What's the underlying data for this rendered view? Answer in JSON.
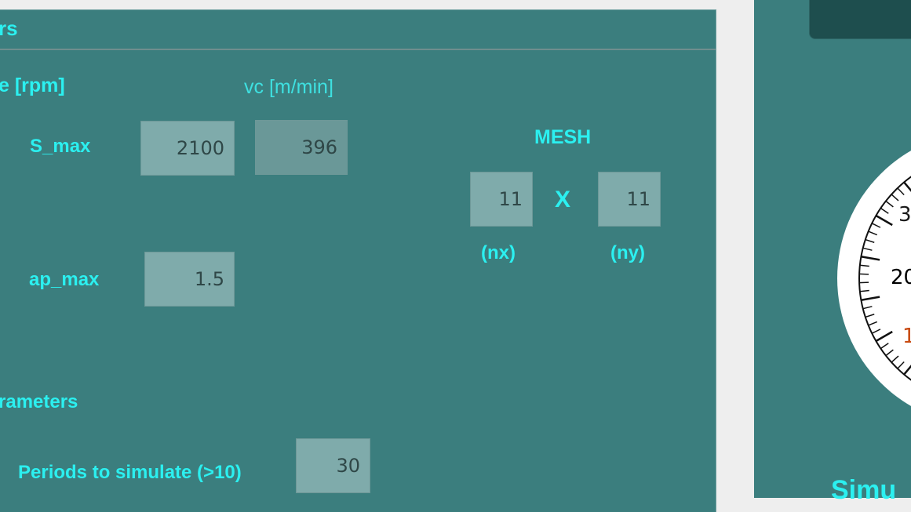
{
  "panel": {
    "header_title": "rs",
    "speed_header": "e [rpm]",
    "vc_header": "vc [m/min]",
    "params_section": "rameters"
  },
  "spindle": {
    "s_max_label": "S_max",
    "s_max_value": "2100",
    "vc_value": "396"
  },
  "depth": {
    "ap_max_label": "ap_max",
    "ap_max_value": "1.5"
  },
  "mesh": {
    "title": "MESH",
    "nx_value": "11",
    "times_symbol": "X",
    "ny_value": "11",
    "nx_label": "(nx)",
    "ny_label": "(ny)"
  },
  "simulation": {
    "periods_label": "Periods to simulate (>10)",
    "periods_value": "30"
  },
  "gauge": {
    "tick_labels": [
      "3",
      "20",
      "1"
    ],
    "tick_colors": [
      "#1a1a1a",
      "#000000",
      "#c84a10"
    ]
  },
  "right": {
    "sim_label": "Simu"
  }
}
